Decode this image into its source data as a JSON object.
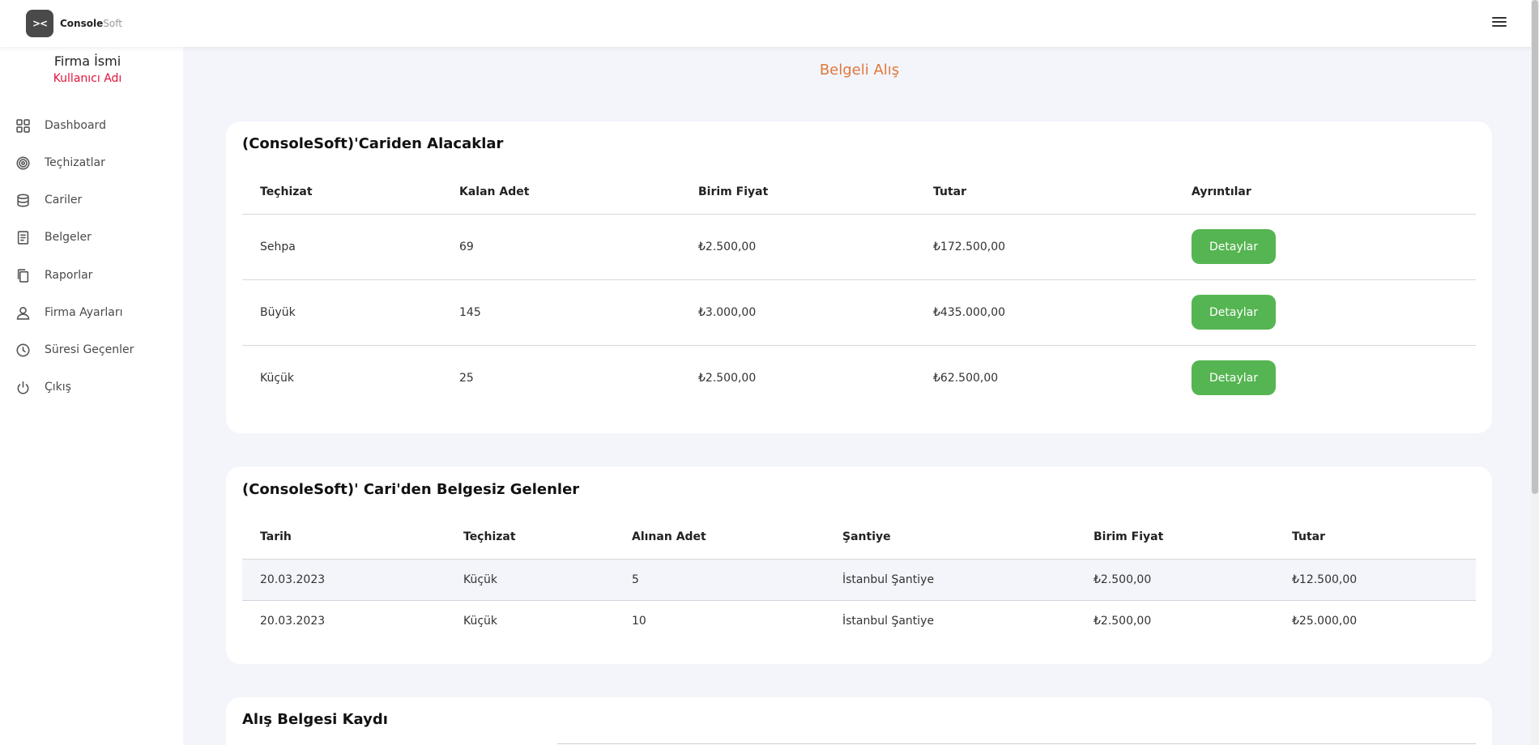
{
  "brand": {
    "mark": "><",
    "name_bold": "Console",
    "name_light": "Soft"
  },
  "sidebar": {
    "firm_name": "Firma İsmi",
    "user_name": "Kullanıcı Adı",
    "items": [
      {
        "label": "Dashboard",
        "icon": "grid-icon"
      },
      {
        "label": "Teçhizatlar",
        "icon": "target-icon"
      },
      {
        "label": "Cariler",
        "icon": "database-icon"
      },
      {
        "label": "Belgeler",
        "icon": "document-icon"
      },
      {
        "label": "Raporlar",
        "icon": "copy-icon"
      },
      {
        "label": "Firma Ayarları",
        "icon": "user-icon"
      },
      {
        "label": "Süresi Geçenler",
        "icon": "clock-icon"
      },
      {
        "label": "Çıkış",
        "icon": "power-icon"
      }
    ]
  },
  "page": {
    "title": "Belgeli Alış"
  },
  "receivables": {
    "title": "(ConsoleSoft)'Cariden Alacaklar",
    "columns": [
      "Teçhizat",
      "Kalan Adet",
      "Birim Fiyat",
      "Tutar",
      "Ayrıntılar"
    ],
    "rows": [
      {
        "item": "Sehpa",
        "qty": "69",
        "unit_price": "₺2.500,00",
        "total": "₺172.500,00",
        "action": "Detaylar"
      },
      {
        "item": "Büyük",
        "qty": "145",
        "unit_price": "₺3.000,00",
        "total": "₺435.000,00",
        "action": "Detaylar"
      },
      {
        "item": "Küçük",
        "qty": "25",
        "unit_price": "₺2.500,00",
        "total": "₺62.500,00",
        "action": "Detaylar"
      }
    ]
  },
  "undocumented": {
    "title": "(ConsoleSoft)' Cari'den Belgesiz Gelenler",
    "columns": [
      "Tarih",
      "Teçhizat",
      "Alınan Adet",
      "Şantiye",
      "Birim Fiyat",
      "Tutar"
    ],
    "rows": [
      {
        "date": "20.03.2023",
        "item": "Küçük",
        "qty": "5",
        "site": "İstanbul Şantiye",
        "unit_price": "₺2.500,00",
        "total": "₺12.500,00"
      },
      {
        "date": "20.03.2023",
        "item": "Küçük",
        "qty": "10",
        "site": "İstanbul Şantiye",
        "unit_price": "₺2.500,00",
        "total": "₺25.000,00"
      }
    ]
  },
  "purchase_record": {
    "title": "Alış Belgesi Kaydı"
  }
}
